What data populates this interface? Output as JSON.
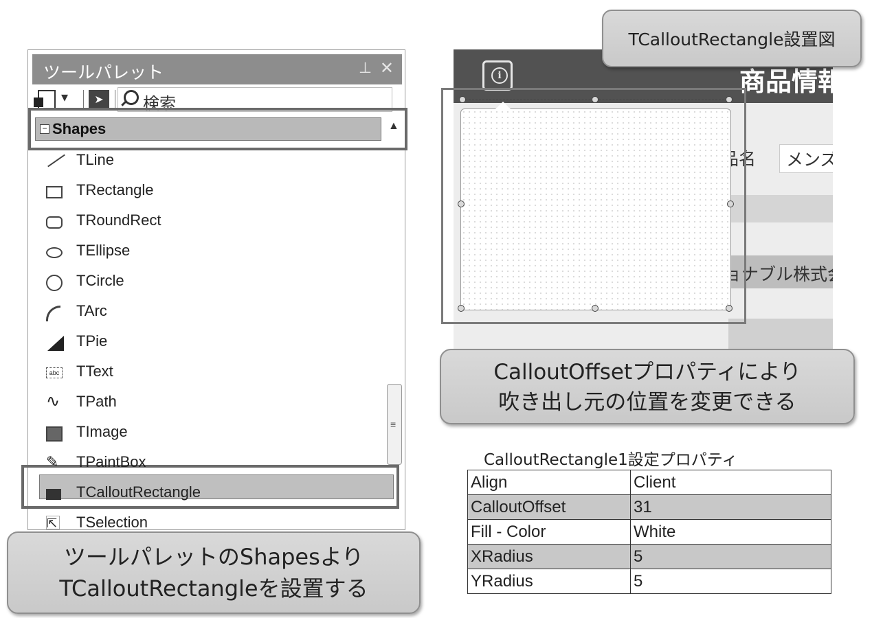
{
  "palette": {
    "title": "ツールパレット",
    "search_placeholder": "検索",
    "category": "Shapes",
    "items": [
      {
        "label": "TLine",
        "icon": "line-icon"
      },
      {
        "label": "TRectangle",
        "icon": "rectangle-icon"
      },
      {
        "label": "TRoundRect",
        "icon": "round-rect-icon"
      },
      {
        "label": "TEllipse",
        "icon": "ellipse-icon"
      },
      {
        "label": "TCircle",
        "icon": "circle-icon"
      },
      {
        "label": "TArc",
        "icon": "arc-icon"
      },
      {
        "label": "TPie",
        "icon": "pie-icon"
      },
      {
        "label": "TText",
        "icon": "text-icon"
      },
      {
        "label": "TPath",
        "icon": "path-icon"
      },
      {
        "label": "TImage",
        "icon": "image-icon"
      },
      {
        "label": "TPaintBox",
        "icon": "paintbox-icon"
      },
      {
        "label": "TCalloutRectangle",
        "icon": "callout-rectangle-icon"
      },
      {
        "label": "TSelection",
        "icon": "selection-icon"
      }
    ]
  },
  "callouts": {
    "left_line1": "ツールパレットのShapesより",
    "left_line2": "TCalloutRectangleを設置する",
    "middle_line1": "CalloutOffsetプロパティにより",
    "middle_line2": "吹き出し元の位置を変更できる",
    "top": "TCalloutRectangle設置図"
  },
  "design": {
    "title": "商品情報",
    "name_label": "品名",
    "name_value": "メンズ",
    "company_text": "ョナブル株式会"
  },
  "properties": {
    "caption": "CalloutRectangle1設定プロパティ",
    "rows": [
      {
        "key": "Align",
        "value": "Client"
      },
      {
        "key": "CalloutOffset",
        "value": "31"
      },
      {
        "key": "Fill - Color",
        "value": "White"
      },
      {
        "key": "XRadius",
        "value": "5"
      },
      {
        "key": "YRadius",
        "value": "5"
      }
    ]
  }
}
